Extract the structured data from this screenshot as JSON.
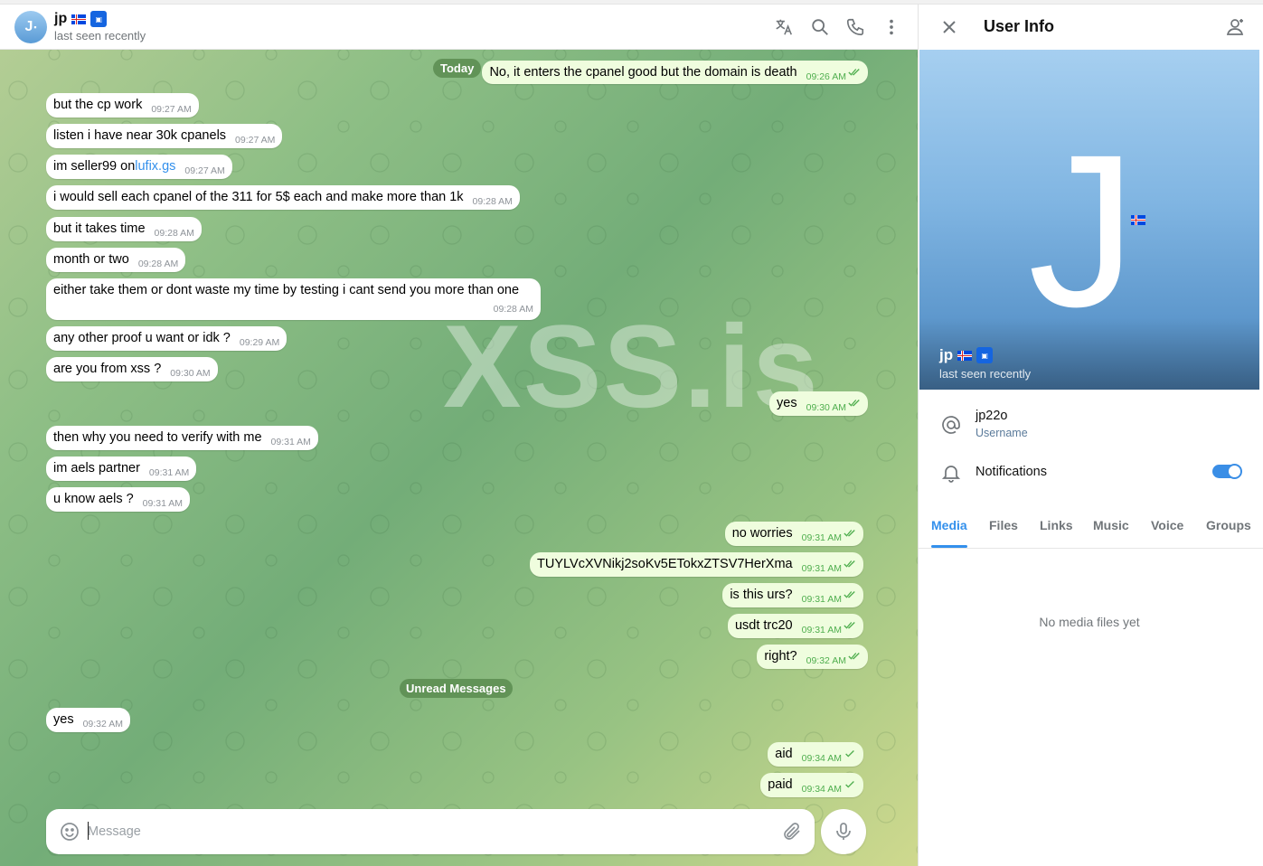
{
  "contact": {
    "name": "jp",
    "avatar_letter": "J",
    "status": "last seen recently",
    "badge_text": "ID"
  },
  "header_icons": [
    "translate-icon",
    "search-icon",
    "phone-icon",
    "more-vert-icon"
  ],
  "watermark": "XSS.is",
  "date_pill": "Today",
  "unread_label": "Unread Messages",
  "messages": [
    {
      "dir": "out",
      "text": "No, it enters the cpanel good but the domain is death",
      "time": "09:26 AM",
      "checks": "double"
    },
    {
      "dir": "in",
      "text": "but the cp work",
      "time": "09:27 AM"
    },
    {
      "dir": "in",
      "text": "listen i have near 30k cpanels",
      "time": "09:27 AM"
    },
    {
      "dir": "in",
      "text_before": "im seller99 on ",
      "link": "lufix.gs",
      "time": "09:27 AM"
    },
    {
      "dir": "in",
      "text": "i would sell each cpanel of the 311 for 5$ each and make more than 1k",
      "time": "09:28 AM"
    },
    {
      "dir": "in",
      "text": "but it takes time",
      "time": "09:28 AM"
    },
    {
      "dir": "in",
      "text": "month or two",
      "time": "09:28 AM"
    },
    {
      "dir": "in",
      "text": "either take them or dont waste my time by testing i cant send you more than one",
      "time": "09:28 AM"
    },
    {
      "dir": "in",
      "text": "any other proof u want or idk ?",
      "time": "09:29 AM"
    },
    {
      "dir": "in",
      "text": "are you from xss ?",
      "time": "09:30 AM"
    },
    {
      "dir": "out",
      "text": "yes",
      "time": "09:30 AM",
      "checks": "double"
    },
    {
      "dir": "in",
      "text": "then why you need to verify with me",
      "time": "09:31 AM"
    },
    {
      "dir": "in",
      "text": "im aels partner",
      "time": "09:31 AM"
    },
    {
      "dir": "in",
      "text": "u know aels ?",
      "time": "09:31 AM"
    },
    {
      "dir": "out",
      "text": "no worries",
      "time": "09:31 AM",
      "checks": "double"
    },
    {
      "dir": "out",
      "text": "TUYLVcXVNikj2soKv5ETokxZTSV7HerXma",
      "time": "09:31 AM",
      "checks": "double"
    },
    {
      "dir": "out",
      "text": "is this urs?",
      "time": "09:31 AM",
      "checks": "double"
    },
    {
      "dir": "out",
      "text": "usdt trc20",
      "time": "09:31 AM",
      "checks": "double"
    },
    {
      "dir": "out",
      "text": "right?",
      "time": "09:32 AM",
      "checks": "double"
    },
    {
      "dir": "in",
      "text": "yes",
      "time": "09:32 AM"
    },
    {
      "dir": "out",
      "text": "aid",
      "time": "09:34 AM",
      "checks": "single"
    },
    {
      "dir": "out",
      "text": "paid",
      "time": "09:34 AM",
      "checks": "single"
    }
  ],
  "composer": {
    "placeholder": "Message",
    "value": ""
  },
  "panel": {
    "title": "User Info",
    "username": "jp22o",
    "username_label": "Username",
    "notifications_label": "Notifications",
    "notifications_on": true,
    "tabs": [
      "Media",
      "Files",
      "Links",
      "Music",
      "Voice",
      "Groups"
    ],
    "active_tab": "Media",
    "empty_text": "No media files yet"
  },
  "colors": {
    "accent": "#3390ec",
    "outgoing_bubble": "#effdde",
    "check_green": "#4fae4e"
  }
}
